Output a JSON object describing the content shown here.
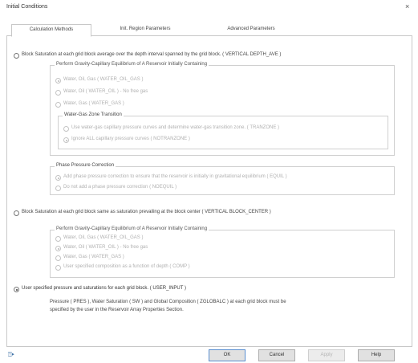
{
  "window": {
    "title": "Initial Conditions",
    "close_glyph": "×"
  },
  "tabs": [
    {
      "label": "Calculation Methods",
      "active": true
    },
    {
      "label": "Init. Region Parameters",
      "active": false
    },
    {
      "label": "Advanced Parameters",
      "active": false
    }
  ],
  "option1": {
    "label": "Block Saturation at each grid block average over the depth interval spanned by the grid block. ( VERTICAL   DEPTH_AVE )",
    "selected": false,
    "gravity_group": {
      "title": "Perform Gravity-Capillary Equilibrium of A Reservoir Initially Containing",
      "items": [
        {
          "label": "Water, Oil, Gas  ( WATER_OIL_GAS )",
          "selected": true
        },
        {
          "label": "Water, Oil  ( WATER_OIL ) - No free gas",
          "selected": false
        },
        {
          "label": "Water, Gas  ( WATER_GAS )",
          "selected": false
        }
      ],
      "transition_group": {
        "title": "Water-Gas Zone Transition",
        "items": [
          {
            "label": "Use water-gas capillary pressure curves and determine water-gas transition zone. ( TRANZONE )",
            "selected": false
          },
          {
            "label": "Ignore  ALL  capillary pressure curves  ( NOTRANZONE )",
            "selected": true
          }
        ]
      }
    },
    "phase_group": {
      "title": "Phase Pressure Correction",
      "items": [
        {
          "label": "Add phase pressure correction to ensure that the reservoir is initially in gravitational equilibrium  ( EQUIL )",
          "selected": true
        },
        {
          "label": "Do not add a phase pressure correction  ( NOEQUIL )",
          "selected": false
        }
      ]
    }
  },
  "option2": {
    "label": "Block Saturation at each grid block same as saturation prevailing at the block center  ( VERTICAL   BLOCK_CENTER )",
    "selected": false,
    "gravity_group": {
      "title": "Perform Gravity-Capillary Equilibrium of A Reservoir Initially Containing",
      "items": [
        {
          "label": "Water, Oil, Gas  ( WATER_OIL_GAS )",
          "selected": false
        },
        {
          "label": "Water, Oil  ( WATER_OIL ) - No free gas",
          "selected": true
        },
        {
          "label": "Water, Gas  ( WATER_GAS )",
          "selected": false
        },
        {
          "label": "User specified composition as a function of depth ( COMP )",
          "selected": false
        }
      ]
    }
  },
  "option3": {
    "label": "User specified pressure and saturations for each grid block. ( USER_INPUT )",
    "selected": true,
    "description_line1": "Pressure ( PRES ), Water Saturation ( SW ) and Global Composition ( ZGLOBALC ) at each grid block must be",
    "description_line2": "specified by the user in the Reservoir Array Properties Section."
  },
  "footer": {
    "icon": "help-pointer-icon",
    "icon_glyph": "⍰▸",
    "ok_label": "OK",
    "cancel_label": "Cancel",
    "apply_label": "Apply",
    "help_label": "Help"
  }
}
